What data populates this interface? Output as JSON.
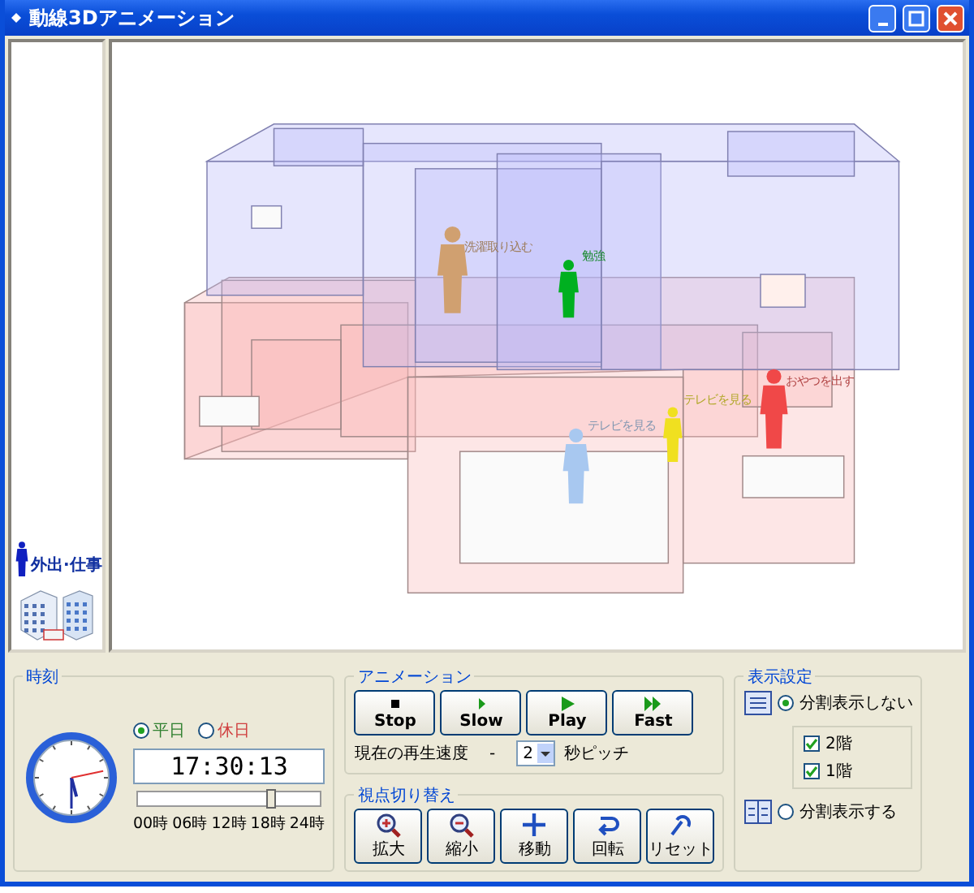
{
  "window": {
    "title": "動線3Dアニメーション"
  },
  "sidebar": {
    "items": [
      {
        "label": "外出·仕事"
      }
    ]
  },
  "scene": {
    "persons": [
      {
        "label": "洗濯取り込む",
        "color": "#d0a070"
      },
      {
        "label": "勉強",
        "color": "#00b020"
      },
      {
        "label": "テレビを見る",
        "color": "#a8c8f0"
      },
      {
        "label": "テレビを見る",
        "color": "#f0e020"
      },
      {
        "label": "おやつを出す",
        "color": "#f04848"
      }
    ]
  },
  "time_panel": {
    "title": "時刻",
    "day_types": [
      {
        "label": "平日",
        "selected": true,
        "color": "#308030"
      },
      {
        "label": "休日",
        "selected": false,
        "color": "#d04040"
      }
    ],
    "time": "17:30:13",
    "level": 0.73,
    "ticks": [
      "00時",
      "06時",
      "12時",
      "18時",
      "24時"
    ]
  },
  "animation": {
    "title": "アニメーション",
    "buttons": [
      {
        "label": "Stop",
        "kind": "stop"
      },
      {
        "label": "Slow",
        "kind": "slow"
      },
      {
        "label": "Play",
        "kind": "play"
      },
      {
        "label": "Fast",
        "kind": "fast"
      }
    ],
    "speed_label": "現在の再生速度",
    "speed_value": "-",
    "pitch": "2",
    "pitch_unit": "秒ピッチ"
  },
  "viewpoint": {
    "title": "視点切り替え",
    "buttons": [
      {
        "label": "拡大",
        "kind": "zoom-in"
      },
      {
        "label": "縮小",
        "kind": "zoom-out"
      },
      {
        "label": "移動",
        "kind": "move"
      },
      {
        "label": "回転",
        "kind": "rotate"
      },
      {
        "label": "リセット",
        "kind": "reset"
      }
    ]
  },
  "display": {
    "title": "表示設定",
    "modes": [
      {
        "label": "分割表示しない",
        "selected": true,
        "floors": [
          {
            "label": "2階",
            "checked": true
          },
          {
            "label": "1階",
            "checked": true
          }
        ]
      },
      {
        "label": "分割表示する",
        "selected": false
      }
    ]
  }
}
